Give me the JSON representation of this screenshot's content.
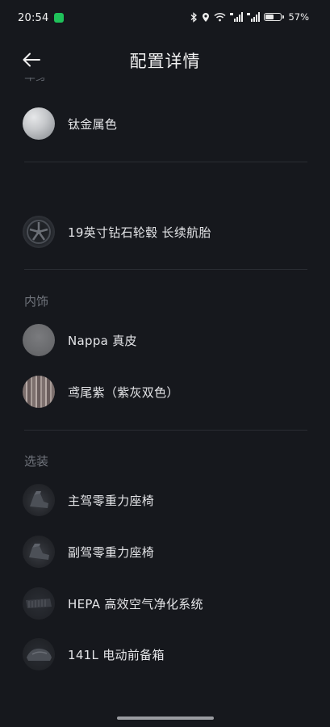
{
  "status_bar": {
    "time": "20:54",
    "battery_percent": "57%",
    "battery_level": 0.57
  },
  "header": {
    "title": "配置详情",
    "back_icon": "arrow-left-icon"
  },
  "cut_section_label": "车身",
  "exterior": {
    "color": "钛金属色",
    "wheels": "19英寸钻石轮毂 长续航胎"
  },
  "interior": {
    "label": "内饰",
    "items": [
      "Nappa 真皮",
      "鸢尾紫（紫灰双色）"
    ]
  },
  "options": {
    "label": "选装",
    "items": [
      "主驾零重力座椅",
      "副驾零重力座椅",
      "HEPA 高效空气净化系统",
      "141L 电动前备箱"
    ]
  },
  "colors": {
    "background": "#16181d",
    "text_primary": "#e4e5e8",
    "text_secondary": "#70747c",
    "divider": "#2a2d33"
  }
}
